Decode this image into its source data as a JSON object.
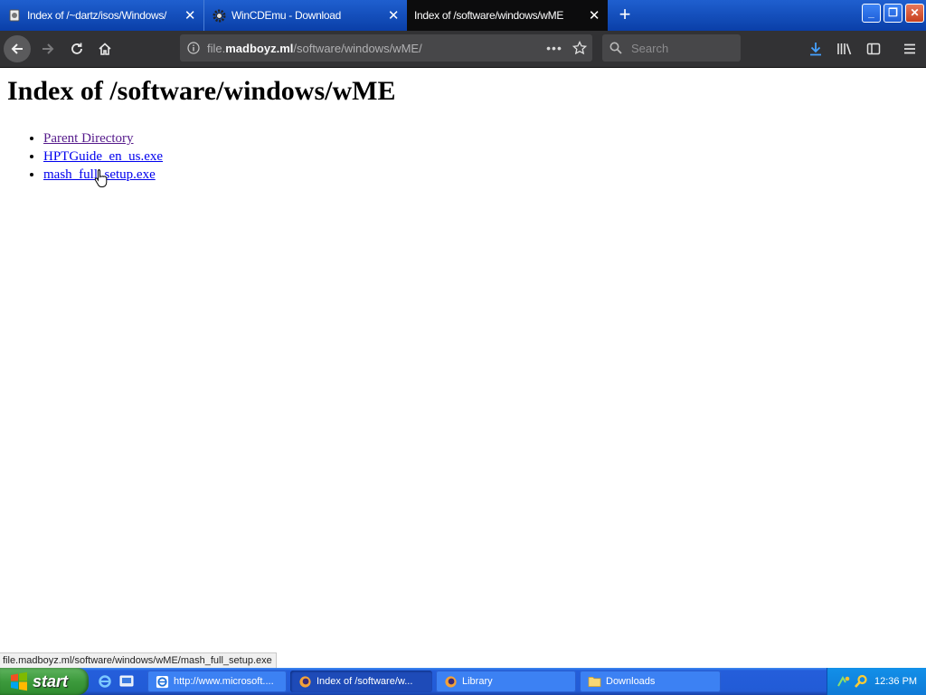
{
  "browser": {
    "tabs": [
      {
        "title": "Index of /~dartz/isos/Windows/",
        "close": "✕",
        "active": false
      },
      {
        "title": "WinCDEmu - Download",
        "close": "✕",
        "active": false
      },
      {
        "title": "Index of /software/windows/wME",
        "close": "✕",
        "active": true
      }
    ],
    "new_tab": "+",
    "window_controls": {
      "minimize": "_",
      "maximize": "❐",
      "close": "✕"
    },
    "url": {
      "prefix": "file.",
      "domain": "madboyz.ml",
      "path": "/software/windows/wME/"
    },
    "url_more": "•••",
    "search": {
      "placeholder": "Search"
    }
  },
  "page": {
    "heading": "Index of /software/windows/wME",
    "links": [
      {
        "label": "Parent Directory",
        "visited": true
      },
      {
        "label": "HPTGuide_en_us.exe",
        "visited": false
      },
      {
        "label": "mash_full_setup.exe",
        "visited": false
      }
    ]
  },
  "status": {
    "text": "file.madboyz.ml/software/windows/wME/mash_full_setup.exe"
  },
  "taskbar": {
    "start_label": "start",
    "items": [
      {
        "label": "http://www.microsoft....",
        "icon": "ie-icon",
        "active": false
      },
      {
        "label": "Index of /software/w...",
        "icon": "firefox-icon",
        "active": true
      },
      {
        "label": "Library",
        "icon": "firefox-icon",
        "active": false
      },
      {
        "label": "Downloads",
        "icon": "folder-icon",
        "active": false
      }
    ],
    "clock": "12:36 PM"
  },
  "colors": {
    "tab_strip": "#245edb",
    "active_tab": "#0c0c0d",
    "toolbar": "#323234",
    "link": "#0000ee",
    "visited_link": "#551a8b",
    "taskbar": "#245edb",
    "start_button": "#3c9a3c"
  }
}
